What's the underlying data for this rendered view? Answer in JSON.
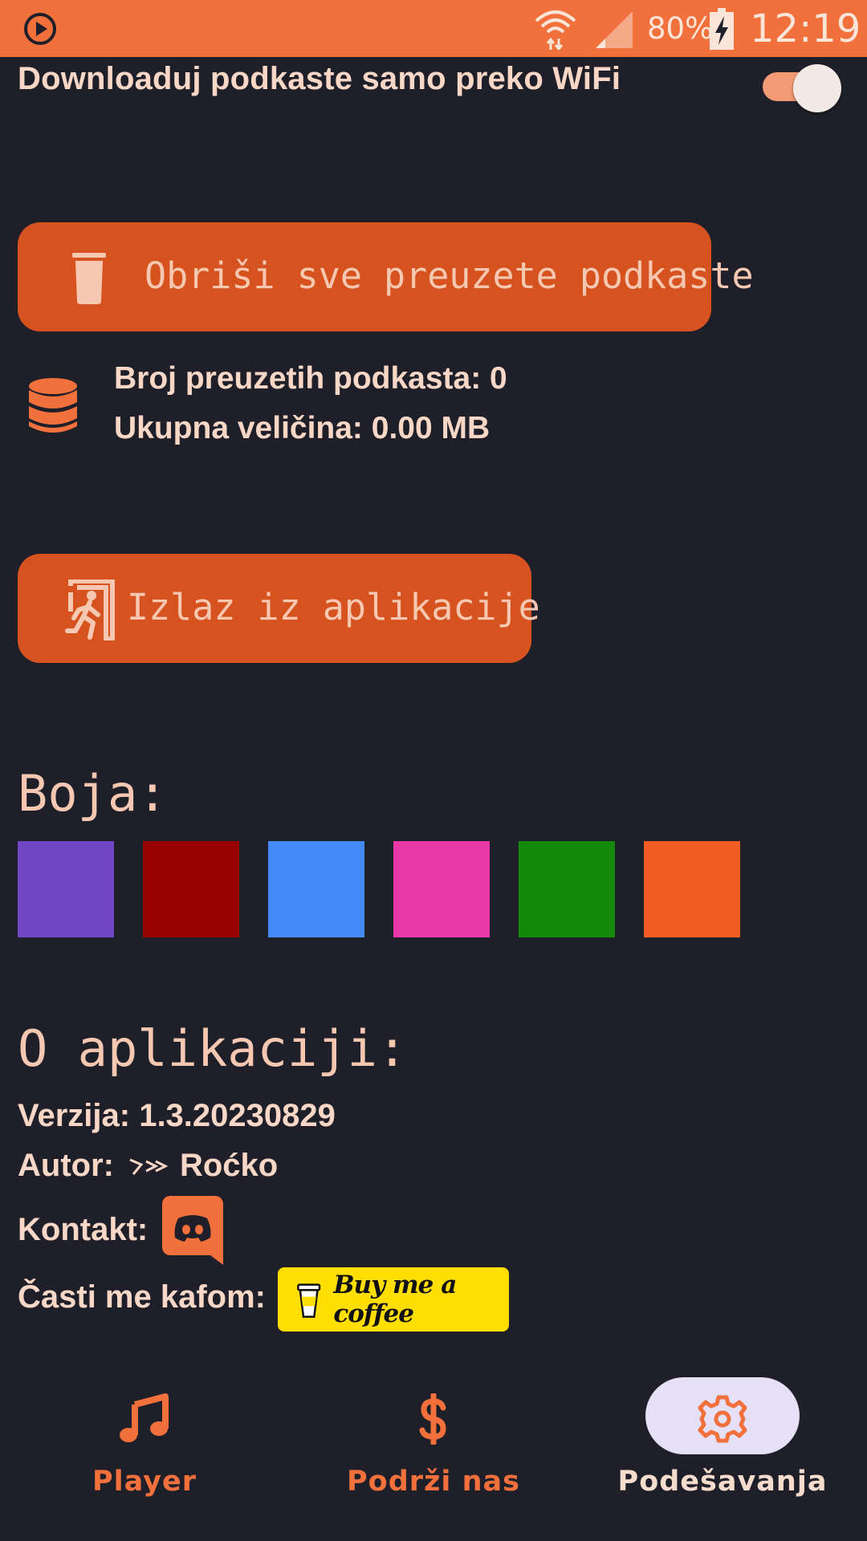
{
  "status_bar": {
    "battery_percent": "80%",
    "time": "12:19",
    "icons": [
      "play-circle-icon",
      "wifi-icon",
      "signal-icon",
      "battery-charging-icon"
    ]
  },
  "settings": {
    "wifi_only_label": "Downloaduj podkaste samo preko WiFi",
    "wifi_only_enabled": true,
    "delete_button_label": "Obriši sve preuzete podkaste",
    "downloaded_count_text": "Broj preuzetih podkasta: 0",
    "total_size_text": "Ukupna veličina: 0.00 MB",
    "exit_button_label": "Izlaz iz aplikacije"
  },
  "color_section": {
    "heading": "Boja:",
    "colors": [
      "#7146c4",
      "#990000",
      "#4489f8",
      "#e838a8",
      "#148a0c",
      "#f05c22"
    ]
  },
  "about": {
    "heading": "O aplikaciji:",
    "version_text": "Verzija: 1.3.20230829",
    "author_label": "Autor:",
    "author_name": "Roćko",
    "contact_label": "Kontakt:",
    "coffee_label": "Časti me kafom:",
    "coffee_button_text": "Buy me a coffee"
  },
  "bottom_nav": {
    "items": [
      {
        "label": "Player",
        "icon": "music-note-icon"
      },
      {
        "label": "Podrži nas",
        "icon": "dollar-icon"
      },
      {
        "label": "Podešavanja",
        "icon": "gear-icon",
        "selected": true
      }
    ]
  },
  "theme": {
    "accent": "#f1703b",
    "button_bg": "#d6531f",
    "background": "#1f1f29",
    "nav_selected_pill": "#e6e0f7"
  }
}
